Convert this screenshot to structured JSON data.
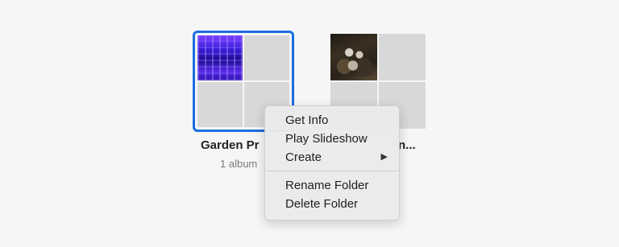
{
  "folders": [
    {
      "name": "Garden Pr",
      "count": "1 album",
      "selected": true,
      "thumb": "greenhouse-photo"
    },
    {
      "name": "n...",
      "thumb": "animals-photo"
    }
  ],
  "context_menu": {
    "items": [
      {
        "label": "Get Info"
      },
      {
        "label": "Play Slideshow"
      },
      {
        "label": "Create",
        "submenu": "triangle-right-icon"
      },
      {
        "label": "Rename Folder"
      },
      {
        "label": "Delete Folder"
      }
    ],
    "submenu_glyph": "▶"
  },
  "colors": {
    "selection_border": "#1a6ee0",
    "background": "#f6f6f6"
  }
}
